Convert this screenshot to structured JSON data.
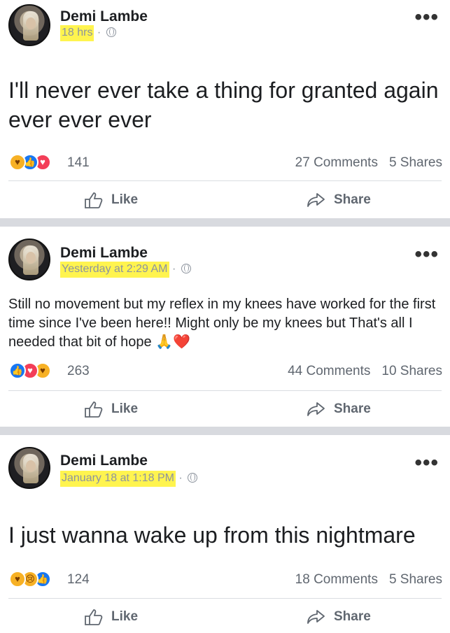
{
  "posts": [
    {
      "author": "Demi Lambe",
      "timestamp": "18 hrs",
      "text": "I'll never ever take a thing for granted again ever ever ever",
      "reactions": [
        "care",
        "like",
        "love"
      ],
      "reaction_count": "141",
      "comments": "27 Comments",
      "shares": "5 Shares",
      "like_label": "Like",
      "share_label": "Share"
    },
    {
      "author": "Demi Lambe",
      "timestamp": "Yesterday at 2:29 AM",
      "text": "Still no movement but my reflex in my knees have worked for the first time since I've been here!! Might only be my knees but That's all I needed that bit of hope 🙏❤️",
      "reactions": [
        "like",
        "love",
        "care"
      ],
      "reaction_count": "263",
      "comments": "44 Comments",
      "shares": "10 Shares",
      "like_label": "Like",
      "share_label": "Share"
    },
    {
      "author": "Demi Lambe",
      "timestamp": "January 18 at 1:18 PM",
      "text": "I just wanna wake up from this nightmare",
      "reactions": [
        "care",
        "sad",
        "like"
      ],
      "reaction_count": "124",
      "comments": "18 Comments",
      "shares": "5 Shares",
      "like_label": "Like",
      "share_label": "Share"
    }
  ],
  "icons": {
    "privacy": "globe-icon",
    "more": "more-options-icon",
    "like": "thumbs-up-icon",
    "share": "share-arrow-icon"
  },
  "colors": {
    "highlight": "#fff44f",
    "like_reaction": "#1877f2",
    "love_reaction": "#f33e58",
    "care_reaction": "#f7b125",
    "separator": "#d8dadf"
  }
}
